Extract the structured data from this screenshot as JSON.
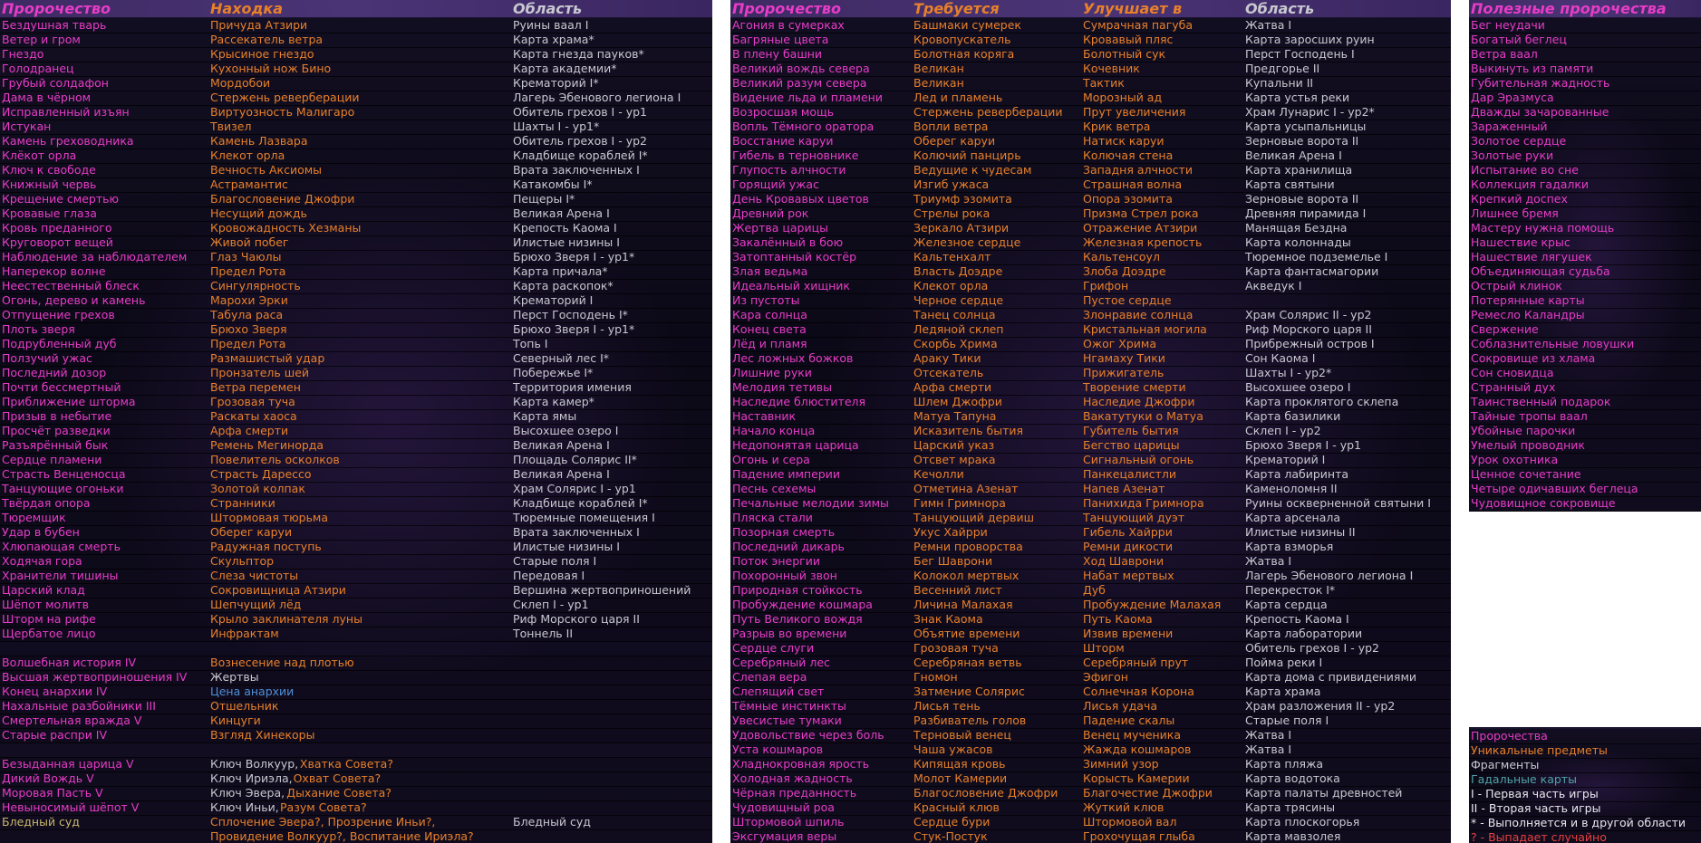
{
  "colors": {
    "prophecy": "#e83cc8",
    "ingredient": "#e8802a",
    "area": "#c8c8d0",
    "header_bg": "#4b3476",
    "accent_blue": "#4f8fd6"
  },
  "panel1": {
    "headers": {
      "prophecy": "Пророчество",
      "ingredient": "Находка",
      "area": "Область"
    },
    "rows": [
      [
        "Бездушная тварь",
        "Причуда Атзири",
        "Руины ваал I"
      ],
      [
        "Ветер и гром",
        "Рассекатель ветра",
        "Карта храма*"
      ],
      [
        "Гнездо",
        "Крысиное гнездо",
        "Карта гнезда пауков*"
      ],
      [
        "Голодранец",
        "Кухонный нож Бино",
        "Карта академии*"
      ],
      [
        "Грубый солдафон",
        "Мордобои",
        "Крематорий I*"
      ],
      [
        "Дама в чёрном",
        "Стержень реверберации",
        "Лагерь Эбенового легиона I"
      ],
      [
        "Исправленный изъян",
        "Виртуозность Малигаро",
        "Обитель грехов I - ур1"
      ],
      [
        "Истукан",
        "Твизел",
        "Шахты I - ур1*"
      ],
      [
        "Камень греховодника",
        "Камень Лазвара",
        "Обитель грехов I - ур2"
      ],
      [
        "Клёкот орла",
        "Клекот орла",
        "Кладбище кораблей I*"
      ],
      [
        "Ключ к свободе",
        "Вечность Аксиомы",
        "Врата заключенных I"
      ],
      [
        "Книжный червь",
        "Астрамантис",
        "Катакомбы I*"
      ],
      [
        "Крещение смертью",
        "Благословение Джофри",
        "Пещеры I*"
      ],
      [
        "Кровавые глаза",
        "Несущий дождь",
        "Великая Арена I"
      ],
      [
        "Кровь преданного",
        "Кровожадность Хезманы",
        "Крепость Каома I"
      ],
      [
        "Круговорот вещей",
        "Живой побег",
        "Илистые низины I"
      ],
      [
        "Наблюдение за наблюдателем",
        "Глаз Чаюлы",
        "Брюхо Зверя I - ур1*"
      ],
      [
        "Наперекор волне",
        "Предел Рота",
        "Карта причала*"
      ],
      [
        "Неестественный блеск",
        "Сингулярность",
        "Карта раскопок*"
      ],
      [
        "Огонь, дерево и камень",
        "Марохи Эрки",
        "Крематорий I"
      ],
      [
        "Отпущение грехов",
        "Табула раса",
        "Перст Господень I*"
      ],
      [
        "Плоть зверя",
        "Брюхо Зверя",
        "Брюхо Зверя I - ур1*"
      ],
      [
        "Подрубленный дуб",
        "Предел Рота",
        "Топь I"
      ],
      [
        "Ползучий ужас",
        "Размашистый удар",
        "Северный лес I*"
      ],
      [
        "Последний дозор",
        "Пронзатель шей",
        "Побережье I*"
      ],
      [
        "Почти бессмертный",
        "Ветра перемен",
        "Территория имения"
      ],
      [
        "Приближение шторма",
        "Грозовая туча",
        "Карта камер*"
      ],
      [
        "Призыв в небытие",
        "Раскаты хаоса",
        "Карта ямы"
      ],
      [
        "Просчёт разведки",
        "Арфа смерти",
        "Высохшее озеро I"
      ],
      [
        "Разъярённый бык",
        "Ремень Мегинорда",
        "Великая Арена I"
      ],
      [
        "Сердце пламени",
        "Повелитель осколков",
        "Площадь Солярис II*"
      ],
      [
        "Страсть Венценосца",
        "Страсть Дарессо",
        "Великая Арена I"
      ],
      [
        "Танцующие огоньки",
        "Золотой колпак",
        "Храм Солярис I - ур1"
      ],
      [
        "Твёрдая опора",
        "Странники",
        "Кладбище кораблей I*"
      ],
      [
        "Тюремщик",
        "Штормовая тюрьма",
        "Тюремные помещения I"
      ],
      [
        "Удар в бубен",
        "Оберег каруи",
        "Врата заключенных I"
      ],
      [
        "Хлюпающая смерть",
        "Радужная поступь",
        "Илистые низины I"
      ],
      [
        "Ходячая гора",
        "Скульптор",
        "Старые поля I"
      ],
      [
        "Хранители тишины",
        "Слеза чистоты",
        "Передовая I"
      ],
      [
        "Царский клад",
        "Сокровищница Атзири",
        "Вершина жертвоприношений"
      ],
      [
        "Шёпот молитв",
        "Шепчущий лёд",
        "Склеп I - ур1"
      ],
      [
        "Шторм на рифе",
        "Крыло заклинателя луны",
        "Риф Морского царя II"
      ],
      [
        "Щербатое лицо",
        "Инфрактам",
        "Тоннель II"
      ],
      [
        "",
        "",
        ""
      ],
      [
        "Волшебная история IV",
        "Вознесение над плотью",
        ""
      ],
      [
        "Высшая жертвоприношения IV",
        "Жертвы",
        ""
      ],
      [
        "Конец анархии IV",
        "Цена анархии",
        ""
      ],
      [
        "Нахальные разбойники III",
        "Отшельник",
        ""
      ],
      [
        "Смертельная вражда V",
        "Кинцуги",
        ""
      ],
      [
        "Старые распри IV",
        "Взгляд Хинекоры",
        ""
      ],
      [
        "",
        "",
        ""
      ],
      [
        "Безыданная царица V",
        "Ключ Волкуур, Хватка Совета?",
        ""
      ],
      [
        "Дикий Вождь V",
        "Ключ Ириэла, Охват Совета?",
        ""
      ],
      [
        "Моровая Пасть V",
        "Ключ Эвера, Дыхание Совета?",
        ""
      ],
      [
        "Невыносимый шёпот V",
        "Ключ Иньи, Разум Совета?",
        ""
      ],
      [
        "Бледный суд",
        "Сплочение Эвера?, Прозрение Иньи?,",
        "Бледный суд"
      ],
      [
        "",
        "Провидение Волкуур?, Воспитание Ириэла?",
        ""
      ]
    ]
  },
  "panel2": {
    "headers": {
      "prophecy": "Пророчество",
      "requires": "Требуется",
      "upgrades": "Улучшает в",
      "area": "Область"
    },
    "rows": [
      [
        "Агония в сумерках",
        "Башмаки сумерек",
        "Сумрачная пагуба",
        "Жатва I"
      ],
      [
        "Багряные цвета",
        "Кровопускатель",
        "Кровавый пляс",
        "Карта заросших руин"
      ],
      [
        "В плену башни",
        "Болотная коряга",
        "Болотный сук",
        "Перст Господень I"
      ],
      [
        "Великий вождь севера",
        "Великан",
        "Кочевник",
        "Предгорье II"
      ],
      [
        "Великий разум севера",
        "Великан",
        "Тактик",
        "Купальни II"
      ],
      [
        "Видение льда и пламени",
        "Лед и пламень",
        "Морозный ад",
        "Карта устья реки"
      ],
      [
        "Возросшая мощь",
        "Стержень реверберации",
        "Прут увеличения",
        "Храм Лунарис I - ур2*"
      ],
      [
        "Вопль Тёмного оратора",
        "Вопли ветра",
        "Крик ветра",
        "Карта усыпальницы"
      ],
      [
        "Восстание каруи",
        "Оберег каруи",
        "Натиск каруи",
        "Зерновые ворота II"
      ],
      [
        "Гибель в терновнике",
        "Колючий панцирь",
        "Колючая стена",
        "Великая Арена I"
      ],
      [
        "Глупость алчности",
        "Ведущие к чудесам",
        "Западня алчности",
        "Карта хранилища"
      ],
      [
        "Горящий ужас",
        "Изгиб ужаса",
        "Страшная волна",
        "Карта святыни"
      ],
      [
        "День Кровавых цветов",
        "Триумф эзомита",
        "Опора эзомита",
        "Зерновые ворота II"
      ],
      [
        "Древний рок",
        "Стрелы рока",
        "Призма Стрел рока",
        "Древняя пирамида I"
      ],
      [
        "Жертва царицы",
        "Зеркало Атзири",
        "Отражение Атзири",
        "Манящая Бездна"
      ],
      [
        "Закалённый в бою",
        "Железное сердце",
        "Железная крепость",
        "Карта колоннады"
      ],
      [
        "Затоптанный костёр",
        "Кальтенхалт",
        "Кальтенсоул",
        "Тюремное подземелье I"
      ],
      [
        "Злая ведьма",
        "Власть Доэдре",
        "Злоба Доэдре",
        "Карта фантасмагории"
      ],
      [
        "Идеальный хищник",
        "Клекот орла",
        "Грифон",
        "Акведук I"
      ],
      [
        "Из пустоты",
        "Черное сердце",
        "Пустое сердце",
        ""
      ],
      [
        "Кара солнца",
        "Танец солнца",
        "Злонравие солнца",
        "Храм Солярис II - ур2"
      ],
      [
        "Конец света",
        "Ледяной склеп",
        "Кристальная могила",
        "Риф Морского царя II"
      ],
      [
        "Лёд и пламя",
        "Скорбь Хрима",
        "Ожог Хрима",
        "Прибрежный остров I"
      ],
      [
        "Лес ложных божков",
        "Араку Тики",
        "Нгамаху Тики",
        "Сон Каома I"
      ],
      [
        "Лишние руки",
        "Отсекатель",
        "Прижигатель",
        "Шахты I - ур2*"
      ],
      [
        "Мелодия тетивы",
        "Арфа смерти",
        "Творение смерти",
        "Высохшее озеро I"
      ],
      [
        "Наследие блюстителя",
        "Шлем Джофри",
        "Наследие Джофри",
        "Карта проклятого склепа"
      ],
      [
        "Наставник",
        "Матуа Тапуна",
        "Вакатутуки о Матуа",
        "Карта базилики"
      ],
      [
        "Начало конца",
        "Исказитель бытия",
        "Губитель бытия",
        "Склеп I - ур2"
      ],
      [
        "Недопонятая царица",
        "Царский указ",
        "Бегство царицы",
        "Брюхо Зверя I - ур1"
      ],
      [
        "Огонь и сера",
        "Отсвет мрака",
        "Сигнальный огонь",
        "Крематорий I"
      ],
      [
        "Падение империи",
        "Кечолли",
        "Панкецалистли",
        "Карта лабиринта"
      ],
      [
        "Песнь сехемы",
        "Отметина Азенат",
        "Напев Азенат",
        "Каменоломня II"
      ],
      [
        "Печальные мелодии зимы",
        "Гимн Гримнора",
        "Панихида Гримнора",
        "Руины оскверненной святыни I"
      ],
      [
        "Пляска стали",
        "Танцующий дервиш",
        "Танцующий дуэт",
        "Карта арсенала"
      ],
      [
        "Позорная смерть",
        "Укус Хайрри",
        "Гибель Хайрри",
        "Илистые низины II"
      ],
      [
        "Последний дикарь",
        "Ремни проворства",
        "Ремни дикости",
        "Карта взморья"
      ],
      [
        "Поток энергии",
        "Бег Шаврони",
        "Ход Шаврони",
        "Жатва I"
      ],
      [
        "Похоронный звон",
        "Колокол мертвых",
        "Набат мертвых",
        "Лагерь Эбенового легиона I"
      ],
      [
        "Природная стойкость",
        "Весенний лист",
        "Дуб",
        "Перекресток I*"
      ],
      [
        "Пробуждение кошмара",
        "Личина Малахая",
        "Пробуждение Малахая",
        "Карта сердца"
      ],
      [
        "Путь Великого вождя",
        "Знак Каома",
        "Путь Каома",
        "Крепость Каома I"
      ],
      [
        "Разрыв во времени",
        "Объятие времени",
        "Извив времени",
        "Карта лаборатории"
      ],
      [
        "Сердце слуги",
        "Грозовая туча",
        "Шторм",
        "Обитель грехов I - ур2"
      ],
      [
        "Серебряный лес",
        "Серебряная ветвь",
        "Серебряный прут",
        "Пойма реки I"
      ],
      [
        "Слепая вера",
        "Гномон",
        "Эфигон",
        "Карта дома с привидениями"
      ],
      [
        "Слепящий свет",
        "Затмение Солярис",
        "Солнечная Корона",
        "Карта храма"
      ],
      [
        "Тёмные инстинкты",
        "Лисья тень",
        "Лисья удача",
        "Храм разложения II - ур2"
      ],
      [
        "Увесистые тумаки",
        "Разбиватель голов",
        "Падение скалы",
        "Старые поля I"
      ],
      [
        "Удовольствие через боль",
        "Терновый венец",
        "Венец мученика",
        "Жатва I"
      ],
      [
        "Уста кошмаров",
        "Чаша ужасов",
        "Жажда кошмаров",
        "Жатва I"
      ],
      [
        "Хладнокровная ярость",
        "Кипящая кровь",
        "Зимний узор",
        "Карта пляжа"
      ],
      [
        "Холодная жадность",
        "Молот Камерии",
        "Корысть Камерии",
        "Карта водотока"
      ],
      [
        "Чёрная преданность",
        "Благословение Джофри",
        "Благочестие Джофри",
        "Карта палаты древностей"
      ],
      [
        "Чудовищный роа",
        "Красный клюв",
        "Жуткий клюв",
        "Карта трясины"
      ],
      [
        "Штормовой шпиль",
        "Сердце бури",
        "Штормовой вал",
        "Карта плоскогорья"
      ],
      [
        "Эксгумация веры",
        "Стук-Постук",
        "Грохочущая глыба",
        "Карта мавзолея"
      ]
    ]
  },
  "panel3": {
    "header": "Полезные пророчества",
    "items": [
      "Бег неудачи",
      "Богатый беглец",
      "Ветра ваал",
      "Выкинуть из памяти",
      "Губительная жадность",
      "Дар Эразмуса",
      "Дважды зачарованные",
      "Зараженный",
      "Золотое сердце",
      "Золотые руки",
      "Испытание во сне",
      "Коллекция гадалки",
      "Крепкий доспех",
      "Лишнее бремя",
      "Мастеру нужна помощь",
      "Нашествие крыс",
      "Нашествие лягушек",
      "Объединяющая судьба",
      "Острый клинок",
      "Потерянные карты",
      "Ремесло Каландры",
      "Свержение",
      "Соблазнительные ловушки",
      "Сокровище из хлама",
      "Сон сновидца",
      "Странный дух",
      "Таинственный подарок",
      "Тайные тропы ваал",
      "Убойные парочки",
      "Умелый проводник",
      "Урок охотника",
      "Ценное сочетание",
      "Четыре одичавших беглеца",
      "Чудовищное сокровище"
    ],
    "legend": [
      {
        "text": "Пророчества",
        "tone": "pink"
      },
      {
        "text": "Уникальные предметы",
        "tone": "orange"
      },
      {
        "text": "Фрагменты",
        "tone": "gray"
      },
      {
        "text": "Гадальные карты",
        "tone": "teal"
      },
      {
        "text": "I - Первая часть игры",
        "tone": "white"
      },
      {
        "text": "II - Вторая часть игры",
        "tone": "white"
      },
      {
        "text": "* - Выполняется и в другой области",
        "tone": "white"
      },
      {
        "text": "? - Выпадает случайно",
        "tone": "red"
      }
    ]
  }
}
